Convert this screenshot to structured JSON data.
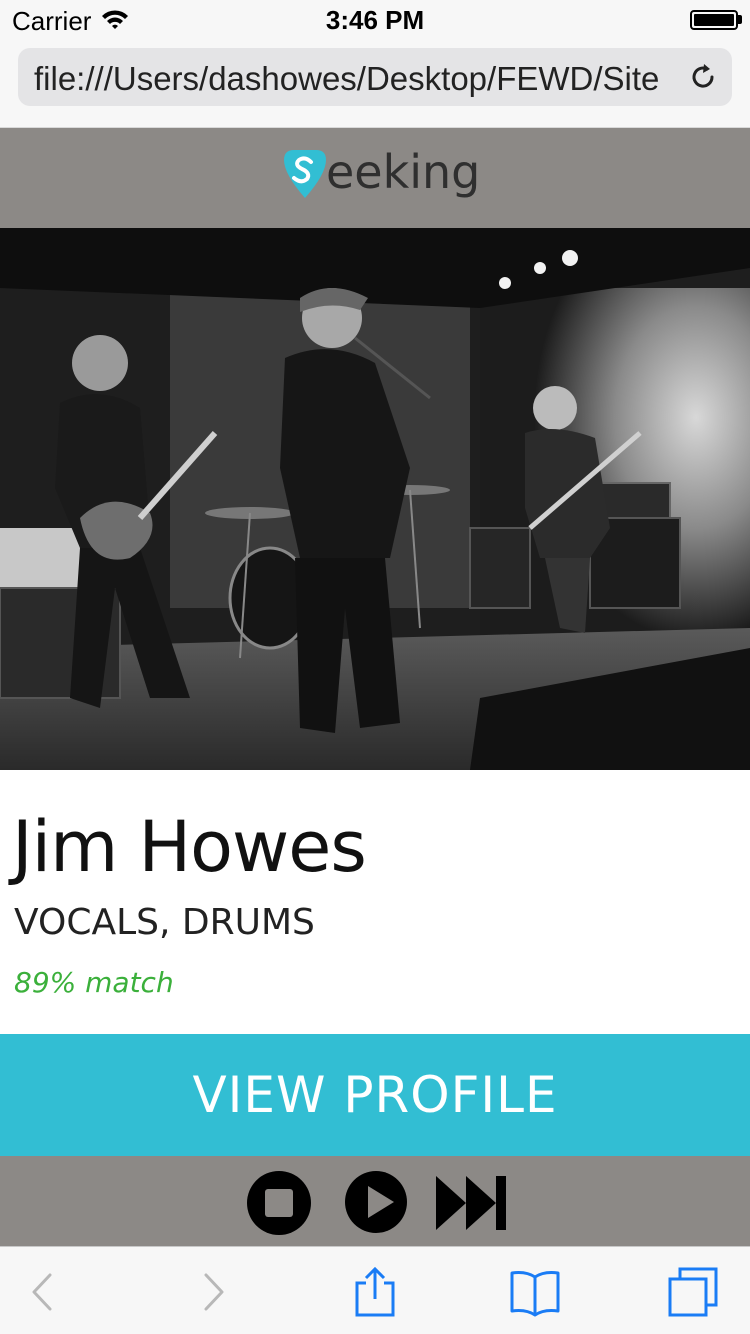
{
  "status_bar": {
    "carrier": "Carrier",
    "time": "3:46 PM"
  },
  "browser": {
    "url": "file:///Users/dashowes/Desktop/FEWD/Site"
  },
  "header": {
    "logo_text": "seeking",
    "accent_color": "#32bed3"
  },
  "profile": {
    "name": "Jim Howes",
    "roles": "VOCALS, DRUMS",
    "match": "89% match",
    "match_color": "#3bb03b"
  },
  "cta": {
    "view_profile_label": "VIEW PROFILE"
  },
  "player": {
    "controls": [
      "stop-icon",
      "play-icon",
      "skip-forward-icon"
    ]
  },
  "toolbar": {
    "icons": [
      "back-icon",
      "forward-icon",
      "share-icon",
      "bookmarks-icon",
      "tabs-icon"
    ],
    "tint_color": "#1a7cf5"
  }
}
